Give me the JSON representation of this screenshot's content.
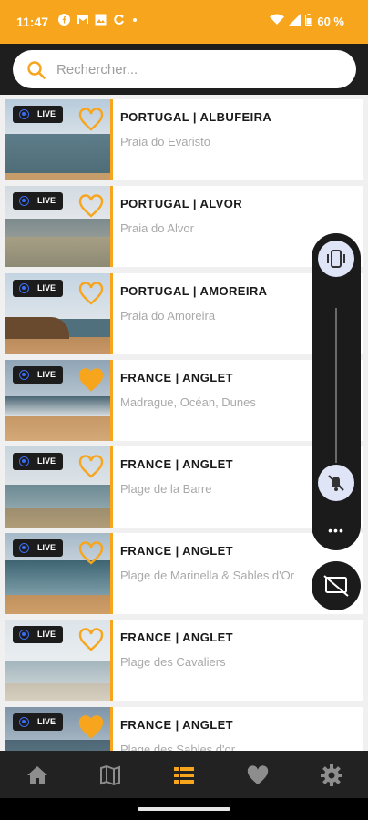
{
  "status_bar": {
    "time": "11:47",
    "battery": "60 %",
    "notification_icons": [
      "facebook-icon",
      "gmail-icon",
      "image-icon",
      "sync-icon",
      "dot-icon"
    ]
  },
  "search": {
    "placeholder": "Rechercher..."
  },
  "colors": {
    "accent": "#f7a51d",
    "live_dot": "#3c6df0"
  },
  "webcams": [
    {
      "live_label": "LIVE",
      "title": "PORTUGAL | ALBUFEIRA",
      "subtitle": "Praia do Evaristo",
      "favorite": false
    },
    {
      "live_label": "LIVE",
      "title": "PORTUGAL | ALVOR",
      "subtitle": "Praia do Alvor",
      "favorite": false
    },
    {
      "live_label": "LIVE",
      "title": "PORTUGAL | AMOREIRA",
      "subtitle": "Praia do Amoreira",
      "favorite": false
    },
    {
      "live_label": "LIVE",
      "title": "FRANCE | ANGLET",
      "subtitle": "Madrague, Océan, Dunes",
      "favorite": true
    },
    {
      "live_label": "LIVE",
      "title": "FRANCE | ANGLET",
      "subtitle": "Plage de la Barre",
      "favorite": false
    },
    {
      "live_label": "LIVE",
      "title": "FRANCE | ANGLET",
      "subtitle": "Plage de Marinella & Sables d'Or",
      "favorite": false
    },
    {
      "live_label": "LIVE",
      "title": "FRANCE | ANGLET",
      "subtitle": "Plage des Cavaliers",
      "favorite": false
    },
    {
      "live_label": "LIVE",
      "title": "FRANCE | ANGLET",
      "subtitle": "Plage des Sables d'or",
      "favorite": true
    }
  ],
  "volume_panel": {
    "ring_mode_icon": "vibrate-icon",
    "mute_icon": "mute-icon",
    "more_label": "•••",
    "cast_icon": "cast-off-icon"
  },
  "bottom_nav": [
    {
      "icon": "home-icon",
      "active": false
    },
    {
      "icon": "map-icon",
      "active": false
    },
    {
      "icon": "list-icon",
      "active": true
    },
    {
      "icon": "heart-icon",
      "active": false
    },
    {
      "icon": "gear-icon",
      "active": false
    }
  ]
}
